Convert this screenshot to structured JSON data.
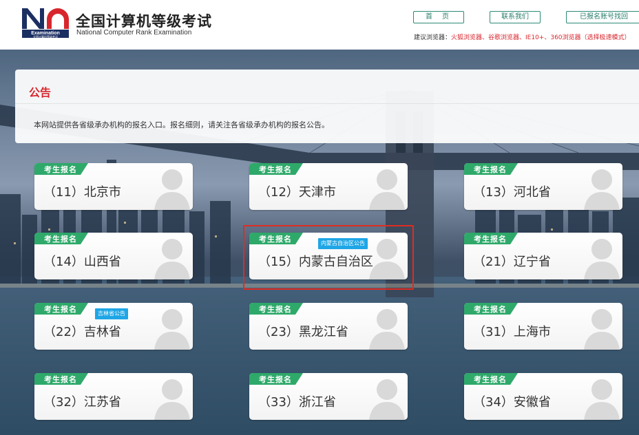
{
  "header": {
    "logo_text": "NCRE",
    "logo_sub": "Examination",
    "logo_sub2": "全国计算机等级考试",
    "title": "全国计算机等级考试",
    "subtitle": "National Computer Rank Examination"
  },
  "nav": {
    "home": "首页",
    "contact": "联系我们",
    "recover": "已报名账号找回"
  },
  "browser_tip": {
    "label": "建议浏览器：",
    "value": "火狐浏览器、谷歌浏览器、IE10+、360浏览器（选择极速模式）"
  },
  "notice": {
    "title": "公告",
    "text": "本网站提供各省级承办机构的报名入口。报名细则，请关注各省级承办机构的报名公告。"
  },
  "colors": {
    "brand_red": "#d8262d",
    "tag_green": "#2fa96a",
    "badge_blue": "#1ea6e6",
    "highlight": "#e02c22"
  },
  "card_tag": "考生报名",
  "provinces": [
    {
      "name": "（11）北京市"
    },
    {
      "name": "（12）天津市"
    },
    {
      "name": "（13）河北省"
    },
    {
      "name": "（14）山西省"
    },
    {
      "name": "（15）内蒙古自治区",
      "badge": "内蒙古自治区公告"
    },
    {
      "name": "（21）辽宁省"
    },
    {
      "name": "（22）吉林省",
      "badge": "吉林省公告"
    },
    {
      "name": "（23）黑龙江省"
    },
    {
      "name": "（31）上海市"
    },
    {
      "name": "（32）江苏省"
    },
    {
      "name": "（33）浙江省"
    },
    {
      "name": "（34）安徽省"
    }
  ]
}
